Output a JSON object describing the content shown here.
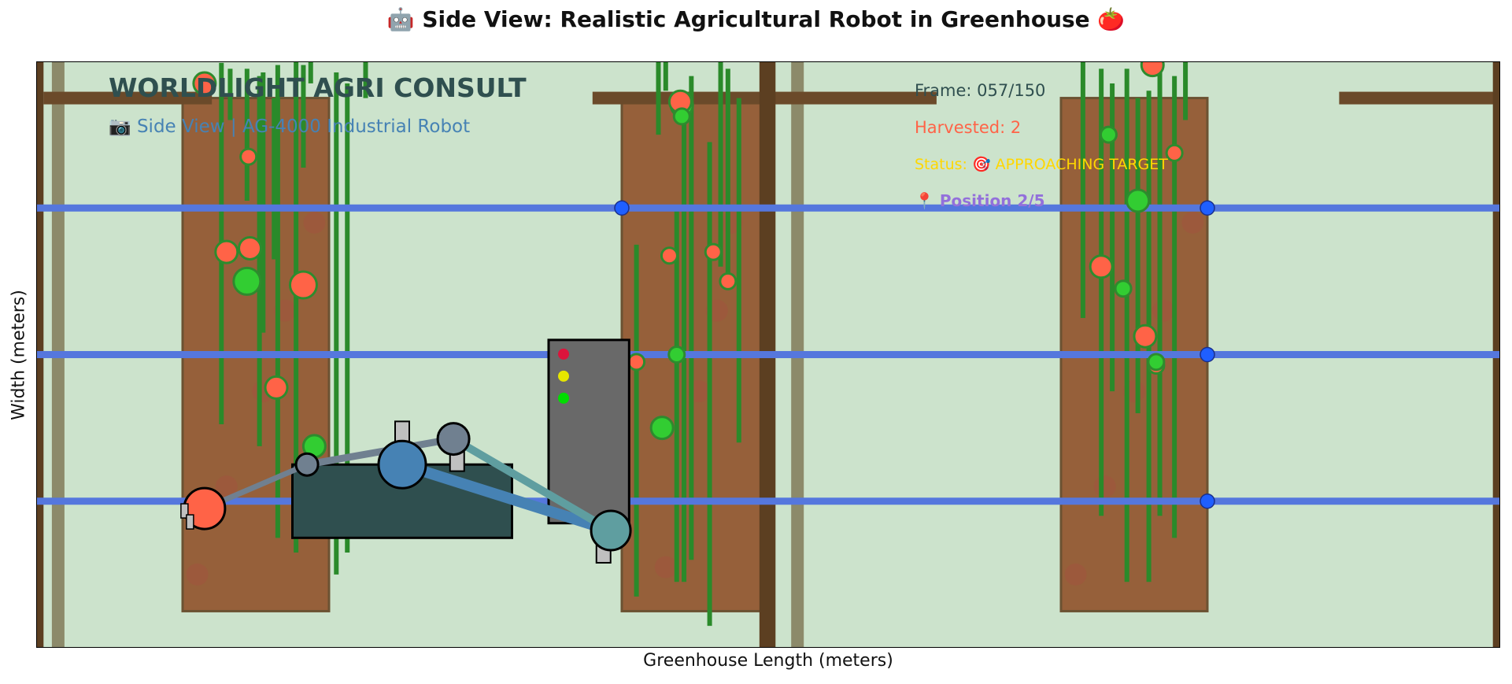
{
  "figure": {
    "title": "🤖 Side View: Realistic Agricultural Robot in Greenhouse 🍅",
    "xlabel": "Greenhouse Length (meters)",
    "ylabel": "Width (meters)"
  },
  "annotations": {
    "company": "WORLDLIGHT AGRI CONSULT",
    "subtitle": "📷 Side View | AG-4000 Industrial Robot",
    "frame": "Frame: 057/150",
    "harvested": "Harvested: 2",
    "status": "Status: 🎯 APPROACHING TARGET",
    "position": "📍 Position 2/5"
  },
  "colors": {
    "background": "#cce3cc",
    "soil_bed": "#96603a",
    "soil_edge": "#6b5232",
    "wood_beam": "#6b4a2a",
    "dark_post": "#5c3f21",
    "side_pillar": "#8c8a6a",
    "rail": "#5577dd",
    "rail_joint": "#1f5fff",
    "stem": "#2a8a2a",
    "tomato_red": "#ff6347",
    "tomato_green": "#32cd32",
    "tomato_edge": "#2e8b2e",
    "robot_body": "#2f4f4f",
    "control_box": "#696969",
    "arm_base": "#4682b4",
    "arm_joint": "#708090",
    "arm_link3": "#5f9ea0",
    "gripper": "#ff6347",
    "company_text": "#2f4f4f",
    "subtitle_text": "#4682b4",
    "frame_text": "#2f4f4f",
    "harvested_text": "#ff6347",
    "status_text": "#ffd700",
    "position_text": "#9370db"
  },
  "chart_data": {
    "type": "scatter",
    "title": "🤖 Side View: Realistic Agricultural Robot in Greenhouse 🍅",
    "xlabel": "Greenhouse Length (meters)",
    "ylabel": "Width (meters)",
    "xlim": [
      0,
      20
    ],
    "ylim": [
      0,
      8
    ],
    "grid": false,
    "ticks": "hidden",
    "growing_beds": [
      {
        "x": [
          2.0,
          4.0
        ],
        "y": [
          0.5,
          7.5
        ]
      },
      {
        "x": [
          8.0,
          10.0
        ],
        "y": [
          0.5,
          7.5
        ]
      },
      {
        "x": [
          14.0,
          16.0
        ],
        "y": [
          0.5,
          7.5
        ]
      }
    ],
    "overhead_beams": [
      {
        "x": [
          0.1,
          2.4
        ],
        "y": 7.5
      },
      {
        "x": [
          7.6,
          12.3
        ],
        "y": 7.5
      },
      {
        "x": [
          17.8,
          20.0
        ],
        "y": 7.5
      }
    ],
    "posts": [
      {
        "x": 0.05,
        "width": 0.1
      },
      {
        "x": 9.99,
        "width": 0.22
      },
      {
        "x": 19.95,
        "width": 0.1
      }
    ],
    "side_pillars": [
      {
        "x": 0.3
      },
      {
        "x": 10.4
      }
    ],
    "rails": [
      {
        "y": 6.0
      },
      {
        "y": 4.0
      },
      {
        "y": 2.0
      }
    ],
    "rail_joints": [
      {
        "x": 8.0,
        "y": 6.0
      },
      {
        "x": 16.0,
        "y": 6.0
      },
      {
        "x": 16.0,
        "y": 4.0
      },
      {
        "x": 16.0,
        "y": 2.0
      }
    ],
    "stems": [
      {
        "x": 2.53,
        "y": [
          3.05,
          7.98
        ]
      },
      {
        "x": 2.65,
        "y": [
          7.2,
          7.9
        ]
      },
      {
        "x": 2.88,
        "y": [
          6.1,
          7.9
        ]
      },
      {
        "x": 3.05,
        "y": [
          2.75,
          7.8
        ]
      },
      {
        "x": 3.1,
        "y": [
          4.3,
          7.85
        ]
      },
      {
        "x": 3.25,
        "y": [
          5.3,
          7.5
        ]
      },
      {
        "x": 3.3,
        "y": [
          1.5,
          7.95
        ]
      },
      {
        "x": 3.55,
        "y": [
          1.3,
          8.0
        ]
      },
      {
        "x": 3.65,
        "y": [
          6.55,
          7.95
        ]
      },
      {
        "x": 3.75,
        "y": [
          7.7,
          8.0
        ]
      },
      {
        "x": 4.1,
        "y": [
          1.0,
          7.85
        ]
      },
      {
        "x": 4.25,
        "y": [
          1.3,
          7.7
        ]
      },
      {
        "x": 4.5,
        "y": [
          7.5,
          8.0
        ]
      },
      {
        "x": 8.2,
        "y": [
          0.7,
          5.5
        ]
      },
      {
        "x": 8.5,
        "y": [
          7.0,
          8.0
        ]
      },
      {
        "x": 8.6,
        "y": [
          7.6,
          8.0
        ]
      },
      {
        "x": 8.75,
        "y": [
          0.9,
          6.0
        ]
      },
      {
        "x": 8.85,
        "y": [
          0.9,
          7.4
        ]
      },
      {
        "x": 8.95,
        "y": [
          1.2,
          7.8
        ]
      },
      {
        "x": 9.2,
        "y": [
          0.3,
          6.9
        ]
      },
      {
        "x": 9.35,
        "y": [
          5.2,
          8.0
        ]
      },
      {
        "x": 9.45,
        "y": [
          5.0,
          7.9
        ]
      },
      {
        "x": 9.6,
        "y": [
          2.8,
          7.5
        ]
      },
      {
        "x": 14.3,
        "y": [
          4.5,
          8.0
        ]
      },
      {
        "x": 14.55,
        "y": [
          1.8,
          7.9
        ]
      },
      {
        "x": 14.7,
        "y": [
          3.5,
          7.7
        ]
      },
      {
        "x": 14.9,
        "y": [
          0.9,
          7.9
        ]
      },
      {
        "x": 15.05,
        "y": [
          3.2,
          7.5
        ]
      },
      {
        "x": 15.2,
        "y": [
          0.9,
          7.6
        ]
      },
      {
        "x": 15.35,
        "y": [
          1.8,
          7.95
        ]
      },
      {
        "x": 15.55,
        "y": [
          1.5,
          7.8
        ]
      },
      {
        "x": 15.7,
        "y": [
          7.2,
          8.0
        ]
      }
    ],
    "tomatoes": [
      {
        "x": 2.3,
        "y": 7.7,
        "ripe": true,
        "size": "medium"
      },
      {
        "x": 2.9,
        "y": 6.7,
        "ripe": true,
        "size": "small"
      },
      {
        "x": 2.6,
        "y": 5.4,
        "ripe": true,
        "size": "medium"
      },
      {
        "x": 2.92,
        "y": 5.45,
        "ripe": true,
        "size": "medium"
      },
      {
        "x": 3.65,
        "y": 4.95,
        "ripe": true,
        "size": "large"
      },
      {
        "x": 2.88,
        "y": 5.0,
        "ripe": false,
        "size": "large"
      },
      {
        "x": 3.28,
        "y": 3.55,
        "ripe": true,
        "size": "medium"
      },
      {
        "x": 3.8,
        "y": 2.75,
        "ripe": false,
        "size": "medium"
      },
      {
        "x": 8.82,
        "y": 7.4,
        "ripe": false,
        "size": "medium"
      },
      {
        "x": 8.8,
        "y": 7.45,
        "ripe": true,
        "size": "medium"
      },
      {
        "x": 8.82,
        "y": 7.25,
        "ripe": false,
        "size": "small"
      },
      {
        "x": 8.65,
        "y": 5.35,
        "ripe": true,
        "size": "small"
      },
      {
        "x": 9.25,
        "y": 5.4,
        "ripe": true,
        "size": "small"
      },
      {
        "x": 9.45,
        "y": 5.0,
        "ripe": true,
        "size": "small"
      },
      {
        "x": 8.75,
        "y": 4.0,
        "ripe": false,
        "size": "small"
      },
      {
        "x": 8.2,
        "y": 3.9,
        "ripe": true,
        "size": "small"
      },
      {
        "x": 8.55,
        "y": 3.0,
        "ripe": false,
        "size": "medium"
      },
      {
        "x": 15.25,
        "y": 7.95,
        "ripe": true,
        "size": "medium"
      },
      {
        "x": 14.65,
        "y": 7.0,
        "ripe": false,
        "size": "small"
      },
      {
        "x": 15.55,
        "y": 6.75,
        "ripe": true,
        "size": "small"
      },
      {
        "x": 15.05,
        "y": 6.1,
        "ripe": false,
        "size": "medium"
      },
      {
        "x": 14.55,
        "y": 5.2,
        "ripe": true,
        "size": "medium"
      },
      {
        "x": 14.85,
        "y": 4.9,
        "ripe": false,
        "size": "small"
      },
      {
        "x": 15.15,
        "y": 4.25,
        "ripe": true,
        "size": "medium"
      },
      {
        "x": 15.3,
        "y": 3.85,
        "ripe": true,
        "size": "small"
      },
      {
        "x": 15.3,
        "y": 3.9,
        "ripe": false,
        "size": "small"
      }
    ],
    "soil_spots": [
      {
        "x": 3.4,
        "y": 4.6
      },
      {
        "x": 3.1,
        "y": 3.5
      },
      {
        "x": 2.6,
        "y": 2.2
      },
      {
        "x": 2.2,
        "y": 1.0
      },
      {
        "x": 3.8,
        "y": 5.8
      },
      {
        "x": 9.5,
        "y": 5.8
      },
      {
        "x": 9.3,
        "y": 4.6
      },
      {
        "x": 9.05,
        "y": 3.5
      },
      {
        "x": 8.6,
        "y": 1.1
      },
      {
        "x": 15.8,
        "y": 5.8
      },
      {
        "x": 15.4,
        "y": 4.6
      },
      {
        "x": 15.0,
        "y": 3.5
      },
      {
        "x": 14.6,
        "y": 2.2
      },
      {
        "x": 14.2,
        "y": 1.0
      }
    ],
    "robot": {
      "body": {
        "x": [
          3.5,
          6.5
        ],
        "y": [
          1.5,
          2.5
        ]
      },
      "control_box": {
        "x": [
          7.0,
          8.1
        ],
        "y": [
          1.7,
          4.2
        ]
      },
      "indicator_lights": [
        "red",
        "yellow",
        "green"
      ],
      "arm_joints": [
        {
          "name": "base",
          "x": 5.0,
          "y": 2.5
        },
        {
          "name": "shoulder",
          "x": 5.7,
          "y": 2.85
        },
        {
          "name": "elbow",
          "x": 3.7,
          "y": 2.5
        },
        {
          "name": "wrist",
          "x": 7.85,
          "y": 1.6
        },
        {
          "name": "gripper",
          "x": 2.3,
          "y": 1.9
        }
      ]
    }
  }
}
